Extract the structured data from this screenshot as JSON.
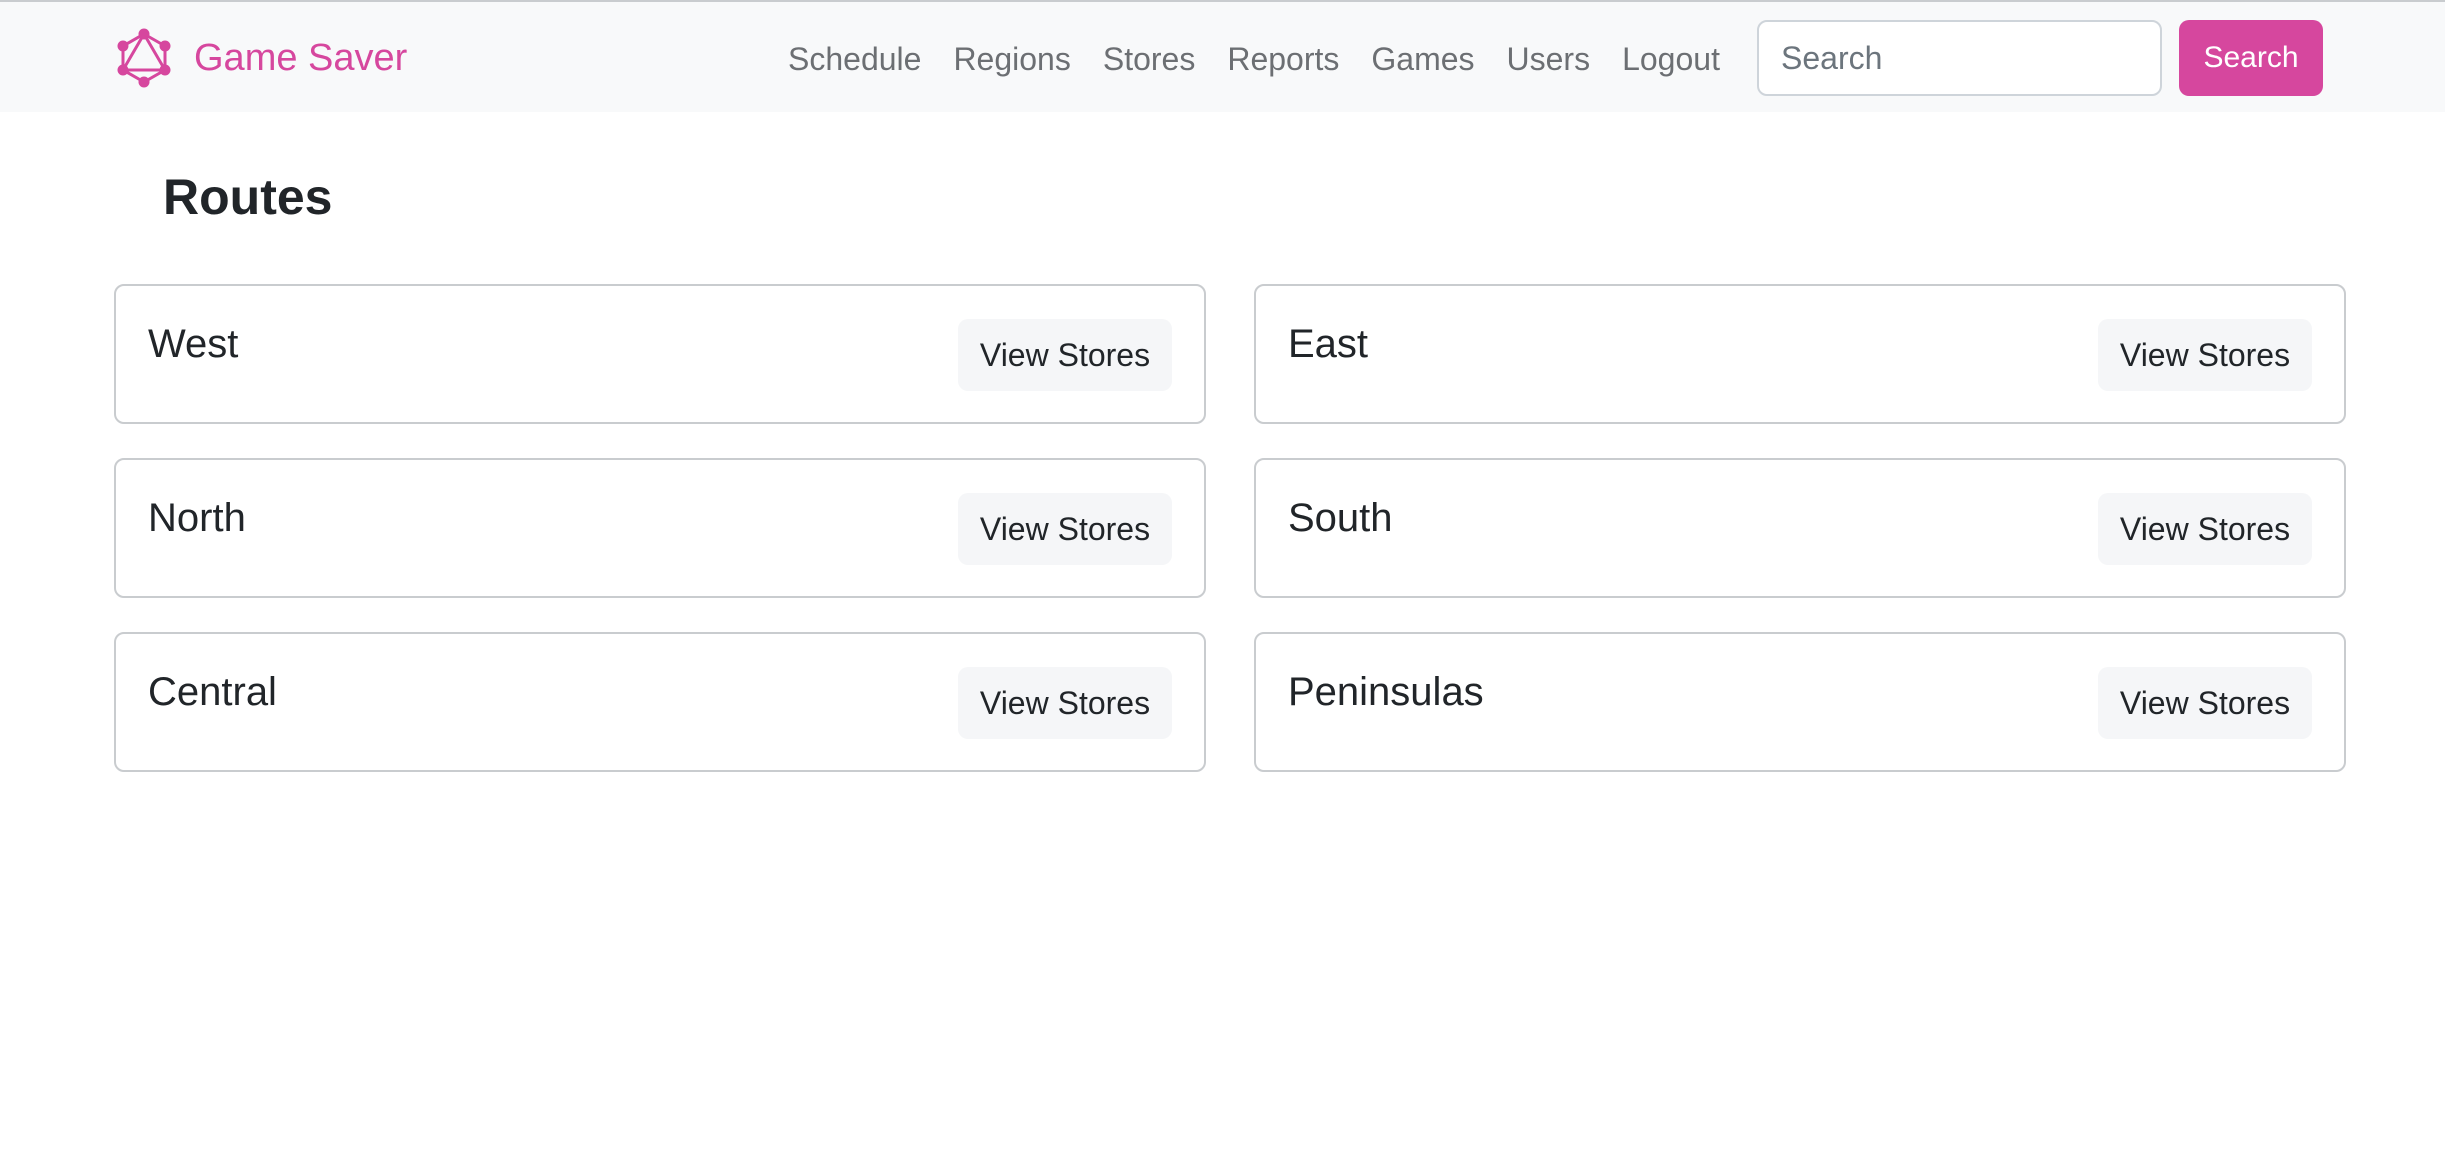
{
  "app": {
    "name": "Game Saver",
    "logo_icon": "graph-network-icon",
    "brand_color": "#d6479e"
  },
  "nav": {
    "links": [
      "Schedule",
      "Regions",
      "Stores",
      "Reports",
      "Games",
      "Users",
      "Logout"
    ]
  },
  "search": {
    "placeholder": "Search",
    "value": "",
    "button_label": "Search"
  },
  "page": {
    "title": "Routes"
  },
  "routes": [
    {
      "name": "West",
      "button_label": "View Stores"
    },
    {
      "name": "East",
      "button_label": "View Stores"
    },
    {
      "name": "North",
      "button_label": "View Stores"
    },
    {
      "name": "South",
      "button_label": "View Stores"
    },
    {
      "name": "Central",
      "button_label": "View Stores"
    },
    {
      "name": "Peninsulas",
      "button_label": "View Stores"
    }
  ]
}
